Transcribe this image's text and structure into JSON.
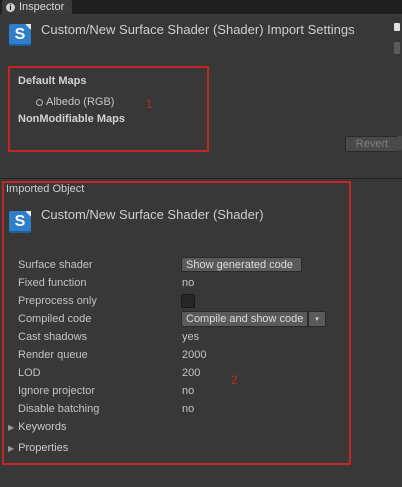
{
  "tab": {
    "label": "Inspector"
  },
  "import_settings": {
    "title": "Custom/New Surface Shader (Shader) Import Settings",
    "default_maps_label": "Default Maps",
    "albedo_label": "Albedo (RGB)",
    "nonmodifiable_label": "NonModifiable Maps",
    "annotation": "1",
    "revert_label": "Revert"
  },
  "imported_object": {
    "section_label": "Imported Object",
    "title": "Custom/New Surface Shader (Shader)",
    "annotation": "2",
    "rows": [
      {
        "label": "Surface shader",
        "value": "Show generated code",
        "kind": "button"
      },
      {
        "label": "Fixed function",
        "value": "no",
        "kind": "text"
      },
      {
        "label": "Preprocess only",
        "value": "",
        "kind": "checkbox"
      },
      {
        "label": "Compiled code",
        "value": "Compile and show code",
        "kind": "dropdown"
      },
      {
        "label": "Cast shadows",
        "value": "yes",
        "kind": "text"
      },
      {
        "label": "Render queue",
        "value": "2000",
        "kind": "text"
      },
      {
        "label": "LOD",
        "value": "200",
        "kind": "text"
      },
      {
        "label": "Ignore projector",
        "value": "no",
        "kind": "text"
      },
      {
        "label": "Disable batching",
        "value": "no",
        "kind": "text"
      }
    ],
    "foldouts": [
      {
        "label": "Keywords"
      },
      {
        "label": "Properties"
      }
    ]
  },
  "colors": {
    "annotation_red": "#c42525",
    "shader_icon_blue": "#2e7fc9",
    "background": "#383838"
  },
  "icons": {
    "tab": "info-icon",
    "shader": "shader-file-icon",
    "albedo": "radio-circle-icon",
    "foldout": "triangle-right-icon",
    "dropdown": "dropdown-arrow-icon"
  }
}
